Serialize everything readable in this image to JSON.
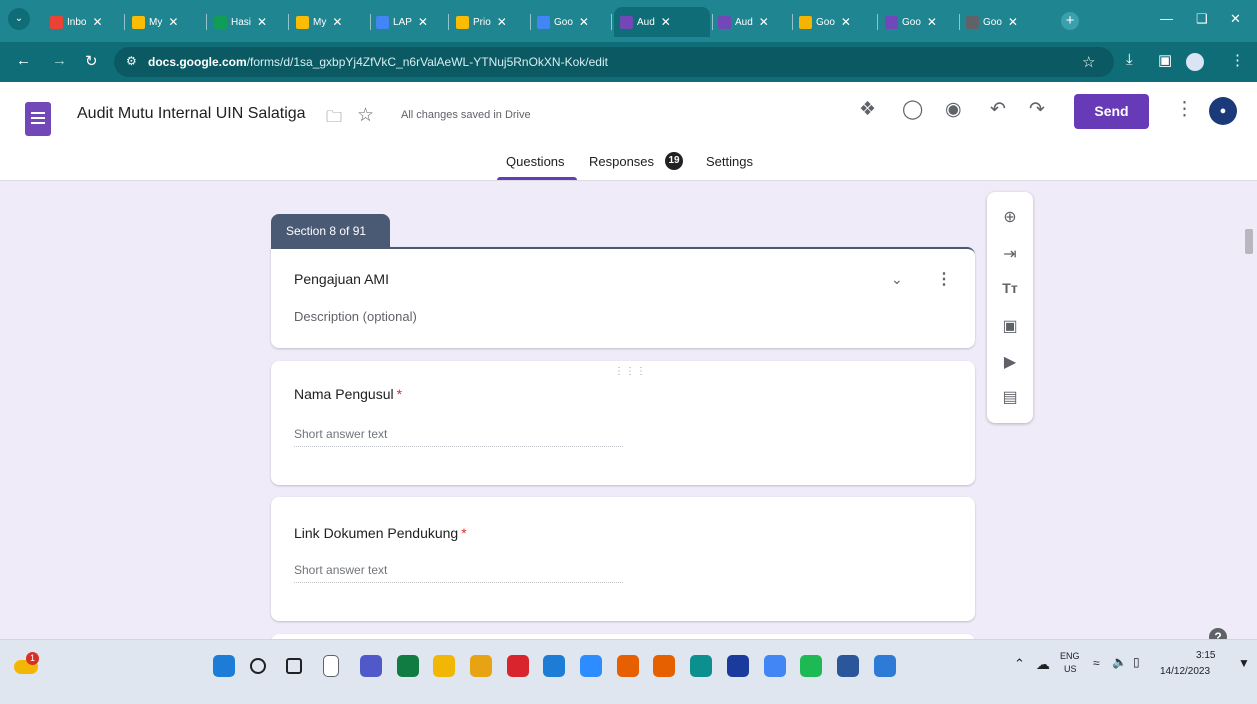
{
  "browser": {
    "tabs": [
      {
        "label": "Inbo",
        "icon": "gmail-icon",
        "color": "#ea4335"
      },
      {
        "label": "My",
        "icon": "drive-icon",
        "color": "#fbbc04"
      },
      {
        "label": "Hasi",
        "icon": "sheets-icon",
        "color": "#0f9d58"
      },
      {
        "label": "My",
        "icon": "drive-icon",
        "color": "#fbbc04"
      },
      {
        "label": "LAP",
        "icon": "docs-icon",
        "color": "#4285f4"
      },
      {
        "label": "Prio",
        "icon": "drive-icon",
        "color": "#fbbc04"
      },
      {
        "label": "Goo",
        "icon": "docs-icon",
        "color": "#4285f4"
      },
      {
        "label": "Aud",
        "icon": "forms-icon",
        "color": "#7248b9"
      },
      {
        "label": "Aud",
        "icon": "forms-icon",
        "color": "#7248b9"
      },
      {
        "label": "Goo",
        "icon": "slides-icon",
        "color": "#f4b400"
      },
      {
        "label": "Goo",
        "icon": "forms-icon",
        "color": "#7248b9"
      },
      {
        "label": "Goo",
        "icon": "forms-icon",
        "color": "#5f6368"
      }
    ],
    "active_tab_index": 7,
    "url_domain": "docs.google.com",
    "url_path": "/forms/d/1sa_gxbpYj4ZfVkC_n6rValAeWL-YTNuj5RnOkXN-Kok/edit"
  },
  "form": {
    "title": "Audit Mutu Internal UIN Salatiga",
    "save_status": "All changes saved in Drive",
    "send_label": "Send",
    "tabs": {
      "questions": "Questions",
      "responses": "Responses",
      "responses_count": "19",
      "settings": "Settings"
    },
    "section": {
      "tag": "Section 8 of 91",
      "title": "Pengajuan AMI",
      "description_placeholder": "Description (optional)"
    },
    "questions": [
      {
        "title": "Nama Pengusul",
        "required_mark": "*",
        "answer_placeholder": "Short answer text"
      },
      {
        "title": "Link Dokumen Pendukung",
        "required_mark": "*",
        "answer_placeholder": "Short answer text"
      }
    ],
    "help_label": "?"
  },
  "taskbar": {
    "weather_badge": "1",
    "lang_top": "ENG",
    "lang_bottom": "US",
    "time": "3:15",
    "date": "14/12/2023"
  },
  "colors": {
    "browser_frame": "#1e8591",
    "forms_accent": "#673ab7",
    "section_tag": "#4a5a75",
    "canvas_bg": "#f0ebf8"
  }
}
